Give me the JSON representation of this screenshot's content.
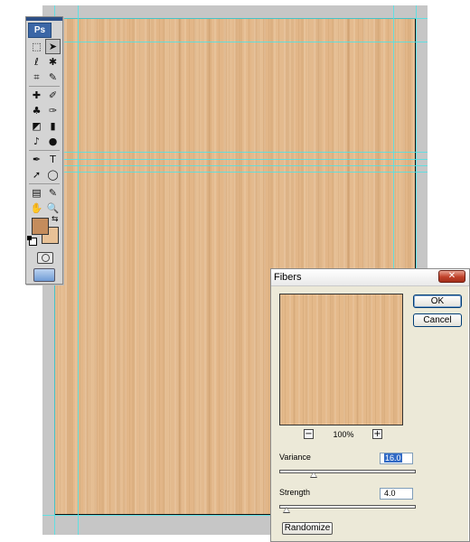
{
  "app": {
    "logo": "Ps"
  },
  "toolbox": {
    "tools": [
      {
        "icon": "marquee-icon",
        "glyph": "⬚"
      },
      {
        "icon": "move-icon",
        "glyph": "➤"
      },
      {
        "icon": "lasso-icon",
        "glyph": "ℓ"
      },
      {
        "icon": "magic-wand-icon",
        "glyph": "✱"
      },
      {
        "icon": "crop-icon",
        "glyph": "⌗"
      },
      {
        "icon": "eyedropper-icon",
        "glyph": "✎"
      },
      {
        "icon": "healing-brush-icon",
        "glyph": "✚"
      },
      {
        "icon": "brush-icon",
        "glyph": "✐"
      },
      {
        "icon": "clone-stamp-icon",
        "glyph": "♣"
      },
      {
        "icon": "history-brush-icon",
        "glyph": "✑"
      },
      {
        "icon": "eraser-icon",
        "glyph": "◩"
      },
      {
        "icon": "gradient-icon",
        "glyph": "▮"
      },
      {
        "icon": "blur-icon",
        "glyph": "♪"
      },
      {
        "icon": "dodge-icon",
        "glyph": "●"
      },
      {
        "icon": "pen-icon",
        "glyph": "✒"
      },
      {
        "icon": "type-icon",
        "glyph": "T"
      },
      {
        "icon": "path-selection-icon",
        "glyph": "➚"
      },
      {
        "icon": "shape-icon",
        "glyph": "◯"
      },
      {
        "icon": "notes-icon",
        "glyph": "▤"
      },
      {
        "icon": "color-sampler-icon",
        "glyph": "✎"
      },
      {
        "icon": "hand-icon",
        "glyph": "✋"
      },
      {
        "icon": "zoom-icon",
        "glyph": "🔍"
      }
    ],
    "foreground_color": "#c48c5c",
    "background_color": "#e8c196"
  },
  "document": {
    "texture_color": "#e2b688",
    "guide_color": "#4fe3e6"
  },
  "fibers_dialog": {
    "title": "Fibers",
    "close_label": "✕",
    "ok_label": "OK",
    "cancel_label": "Cancel",
    "zoom_out_label": "−",
    "zoom_in_label": "+",
    "zoom_level": "100%",
    "variance_label": "Variance",
    "variance_value": "16.0",
    "variance_slider_fraction": 0.25,
    "strength_label": "Strength",
    "strength_value": "4.0",
    "strength_slider_fraction": 0.05,
    "randomize_label": "Randomize"
  }
}
